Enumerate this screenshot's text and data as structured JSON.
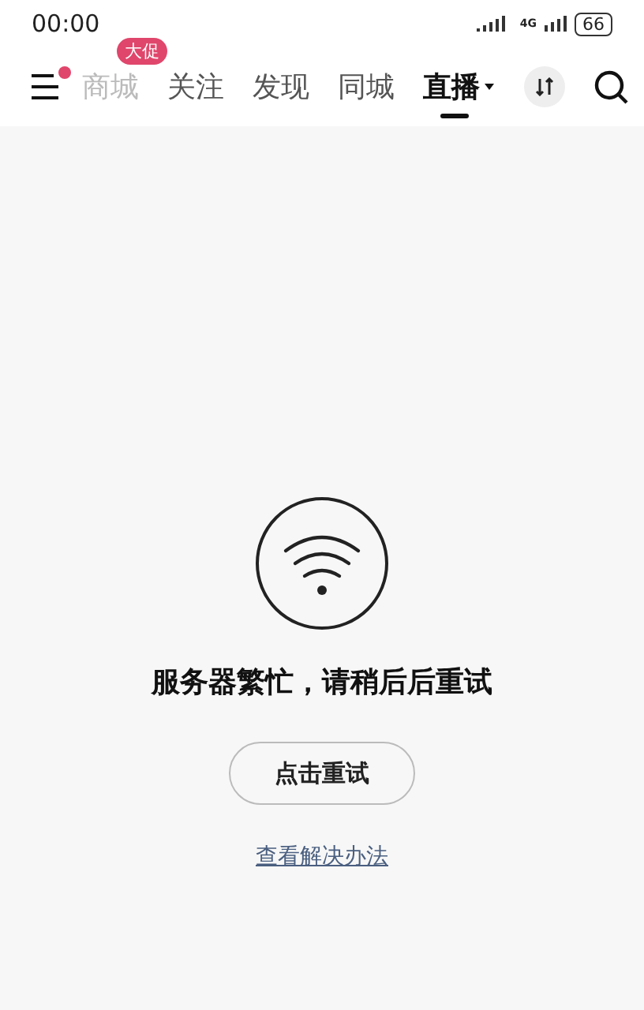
{
  "status_bar": {
    "time": "00:00",
    "network": "4G",
    "battery": "66"
  },
  "nav": {
    "menu_dot": true,
    "tabs": [
      {
        "label": "商城",
        "selected": false,
        "badge": "大促",
        "faded": true
      },
      {
        "label": "关注",
        "selected": false
      },
      {
        "label": "发现",
        "selected": false
      },
      {
        "label": "同城",
        "selected": false
      },
      {
        "label": "直播",
        "selected": true,
        "dropdown": true
      }
    ]
  },
  "error": {
    "message": "服务器繁忙，请稍后后重试",
    "retry_button": "点击重试",
    "help_link": "查看解决办法"
  }
}
